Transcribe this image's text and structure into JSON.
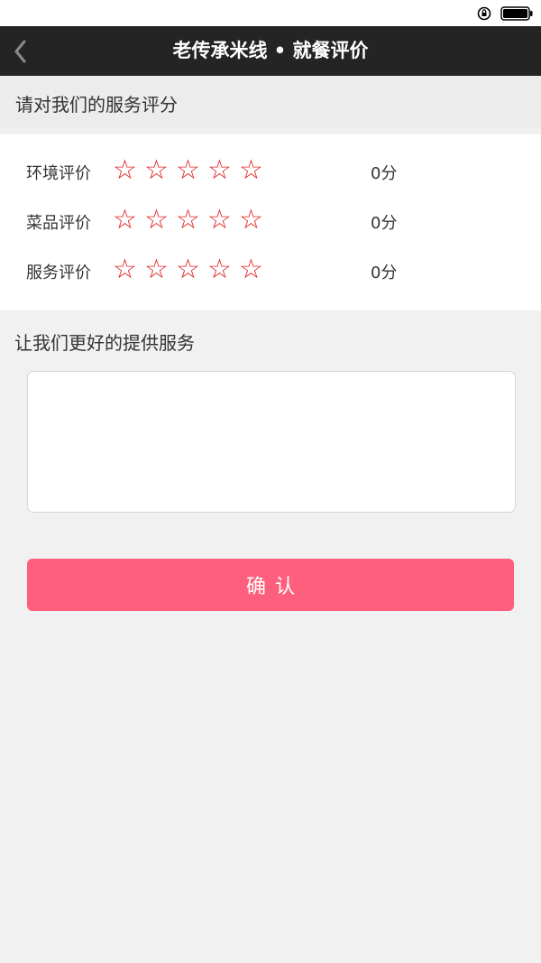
{
  "header": {
    "title": "老传承米线 • 就餐评价",
    "back_icon": "chevron-left-icon"
  },
  "section_title": "请对我们的服务评分",
  "ratings": [
    {
      "label": "环境评价",
      "stars": [
        "☆",
        "☆",
        "☆",
        "☆",
        "☆"
      ],
      "score": "0分"
    },
    {
      "label": "菜品评价",
      "stars": [
        "☆",
        "☆",
        "☆",
        "☆",
        "☆"
      ],
      "score": "0分"
    },
    {
      "label": "服务评价",
      "stars": [
        "☆",
        "☆",
        "☆",
        "☆",
        "☆"
      ],
      "score": "0分"
    }
  ],
  "feedback": {
    "title": "让我们更好的提供服务",
    "value": "",
    "placeholder": ""
  },
  "confirm_label": "确认",
  "colors": {
    "nav_background": "#242424",
    "star": "#e02020",
    "confirm_button": "#fe5f7c",
    "page_background": "#f1f1f1"
  }
}
